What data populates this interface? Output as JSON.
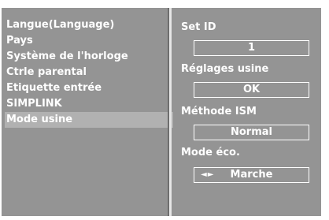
{
  "menu": {
    "items": [
      {
        "label": "Langue(Language)"
      },
      {
        "label": "Pays"
      },
      {
        "label": "Système de l'horloge"
      },
      {
        "label": "Ctrle parental"
      },
      {
        "label": "Etiquette entrée"
      },
      {
        "label": "SIMPLINK"
      },
      {
        "label": "Mode usine"
      }
    ],
    "selected_index": 6
  },
  "settings": {
    "set_id": {
      "label": "Set ID",
      "value": "1"
    },
    "factory_reset": {
      "label": "Réglages usine",
      "value": "OK"
    },
    "ism_method": {
      "label": "Méthode ISM",
      "value": "Normal"
    },
    "eco_mode": {
      "label": "Mode éco.",
      "value": "Marche",
      "arrows": "◄►"
    }
  },
  "colors": {
    "panel_bg": "#949494",
    "selected_row": "#b1b1b1",
    "text": "#ffffff"
  }
}
